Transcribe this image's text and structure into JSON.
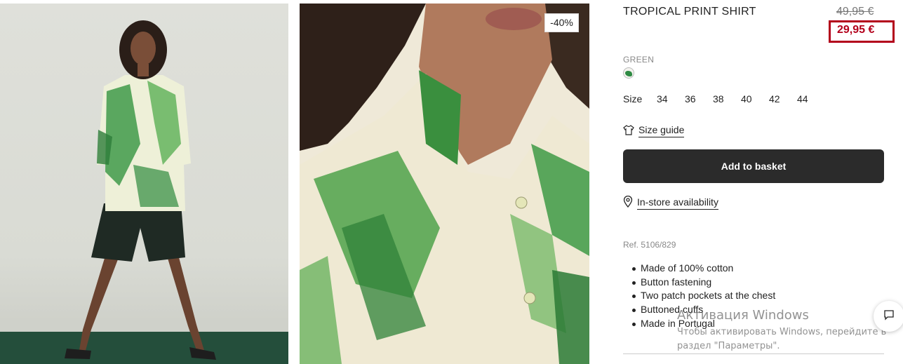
{
  "product": {
    "title": "TROPICAL PRINT SHIRT",
    "old_price": "49,95 €",
    "new_price": "29,95 €",
    "discount_badge": "-40%",
    "color_name": "GREEN",
    "size_label": "Size",
    "sizes": [
      "34",
      "36",
      "38",
      "40",
      "42",
      "44"
    ],
    "size_guide_label": "Size guide",
    "add_to_basket_label": "Add to basket",
    "store_availability_label": "In-store availability",
    "ref": "Ref. 5106/829",
    "features": [
      "Made of 100% cotton",
      "Button fastening",
      "Two patch pockets at the chest",
      "Buttoned cuffs",
      "Made in Portugal"
    ]
  },
  "overlay": {
    "watermark_title": "Активация Windows",
    "watermark_line1": "Чтобы активировать Windows, перейдите в",
    "watermark_line2": "раздел \"Параметры\"."
  },
  "icons": {
    "size_guide": "tshirt-icon",
    "store": "location-pin-icon",
    "chat": "chat-icon"
  },
  "colors": {
    "sale_red": "#b3001b",
    "button_dark": "#2b2b2b",
    "swatch_green": "#2e8a43"
  }
}
